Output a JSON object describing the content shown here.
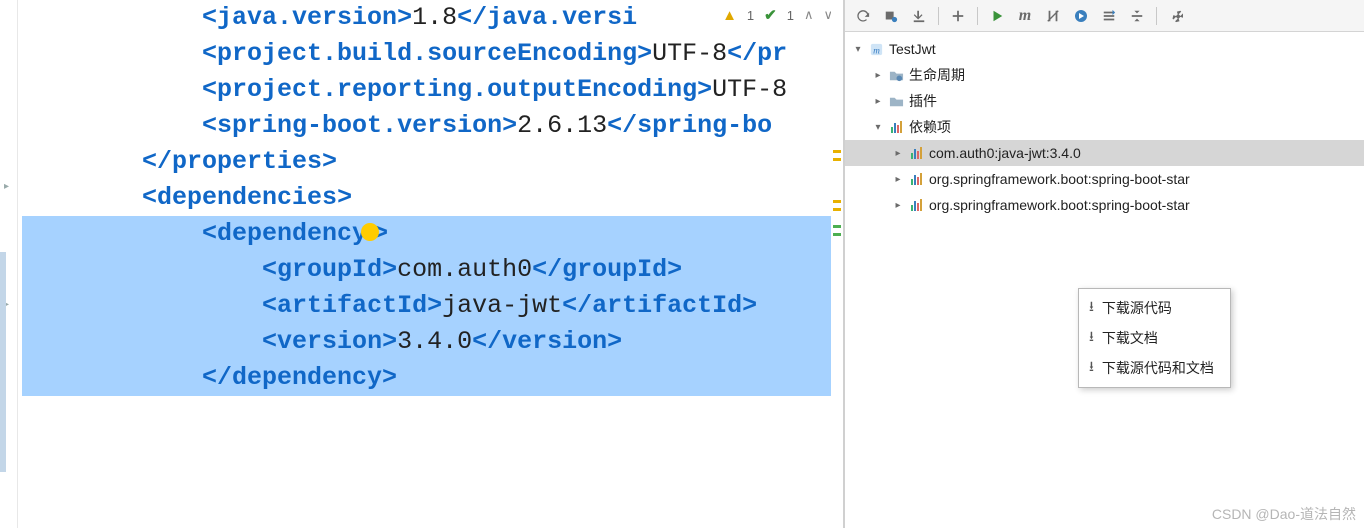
{
  "code": {
    "lines": [
      {
        "type": "prop",
        "tag": "java.version",
        "value": "1.8",
        "indent": 3,
        "truncated_close": "java.versi"
      },
      {
        "type": "prop",
        "tag": "project.build.sourceEncoding",
        "value": "UTF-8",
        "indent": 3,
        "truncated_close": "pr"
      },
      {
        "type": "prop_open_only",
        "tag": "project.reporting.outputEncoding",
        "value_tail": "UTF-8",
        "indent": 3
      },
      {
        "type": "prop",
        "tag": "spring-boot.version",
        "value": "2.6.13",
        "indent": 3,
        "truncated_close": "spring-bo"
      },
      {
        "type": "close",
        "tag": "properties",
        "indent": 2
      },
      {
        "type": "open",
        "tag": "dependencies",
        "indent": 2
      },
      {
        "type": "open_bulb",
        "tag": "dependency",
        "indent": 3,
        "selected": true
      },
      {
        "type": "prop_full",
        "tag": "groupId",
        "value": "com.auth0",
        "indent": 4,
        "selected": true
      },
      {
        "type": "prop_full",
        "tag": "artifactId",
        "value": "java-jwt",
        "indent": 4,
        "selected": true
      },
      {
        "type": "prop_full",
        "tag": "version",
        "value": "3.4.0",
        "indent": 4,
        "selected": true
      },
      {
        "type": "close",
        "tag": "dependency",
        "indent": 3,
        "selected": true
      }
    ]
  },
  "inspections": {
    "warnings": "1",
    "checks": "1"
  },
  "tree": {
    "root": "TestJwt",
    "lifecycle": "生命周期",
    "plugins": "插件",
    "dependencies": "依赖项",
    "deps": [
      "com.auth0:java-jwt:3.4.0",
      "org.springframework.boot:spring-boot-star",
      "org.springframework.boot:spring-boot-star"
    ]
  },
  "context_menu": {
    "download_sources": "下载源代码",
    "download_docs": "下载文档",
    "download_both": "下载源代码和文档"
  },
  "watermark": "CSDN @Dao-道法自然"
}
